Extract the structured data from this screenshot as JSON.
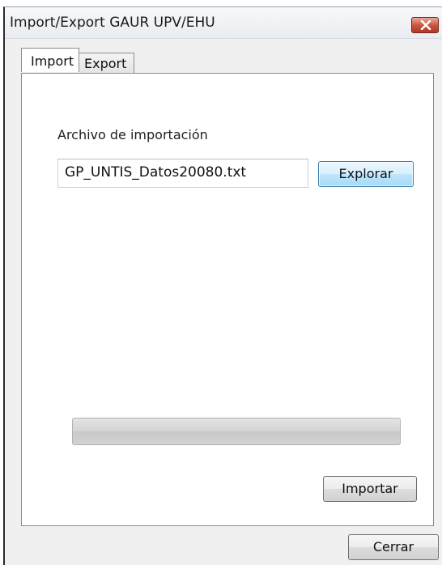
{
  "window": {
    "title": "Import/Export GAUR UPV/EHU"
  },
  "tabs": [
    {
      "label": "Import",
      "active": true
    },
    {
      "label": "Export",
      "active": false
    }
  ],
  "import_panel": {
    "file_label": "Archivo de importación",
    "file_value": "GP_UNTIS_Datos20080.txt",
    "browse_label": "Explorar",
    "progress_percent": 0,
    "import_label": "Importar"
  },
  "footer": {
    "close_label": "Cerrar"
  },
  "colors": {
    "close_button": "#c8513a",
    "browse_border": "#3c7fb1"
  }
}
